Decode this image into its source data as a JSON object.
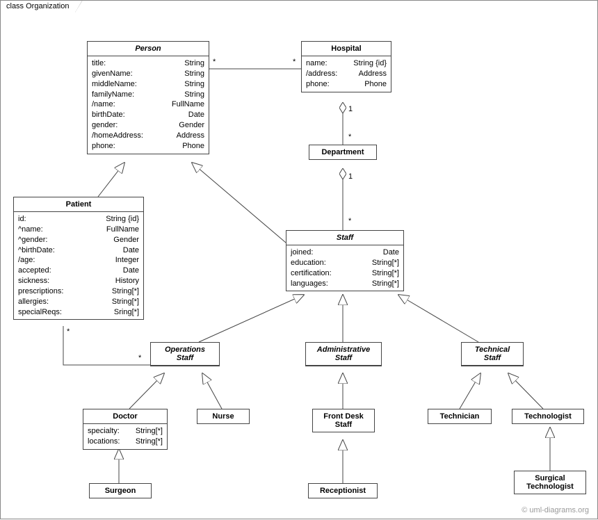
{
  "frame": {
    "title": "class Organization"
  },
  "copyright": "© uml-diagrams.org",
  "classes": {
    "person": {
      "title": "Person",
      "attrs": [
        {
          "k": "title:",
          "v": "String"
        },
        {
          "k": "givenName:",
          "v": "String"
        },
        {
          "k": "middleName:",
          "v": "String"
        },
        {
          "k": "familyName:",
          "v": "String"
        },
        {
          "k": "/name:",
          "v": "FullName"
        },
        {
          "k": "birthDate:",
          "v": "Date"
        },
        {
          "k": "gender:",
          "v": "Gender"
        },
        {
          "k": "/homeAddress:",
          "v": "Address"
        },
        {
          "k": "phone:",
          "v": "Phone"
        }
      ]
    },
    "hospital": {
      "title": "Hospital",
      "attrs": [
        {
          "k": "name:",
          "v": "String {id}"
        },
        {
          "k": "/address:",
          "v": "Address"
        },
        {
          "k": "phone:",
          "v": "Phone"
        }
      ]
    },
    "department": {
      "title": "Department"
    },
    "patient": {
      "title": "Patient",
      "attrs": [
        {
          "k": "id:",
          "v": "String {id}"
        },
        {
          "k": "^name:",
          "v": "FullName"
        },
        {
          "k": "^gender:",
          "v": "Gender"
        },
        {
          "k": "^birthDate:",
          "v": "Date"
        },
        {
          "k": "/age:",
          "v": "Integer"
        },
        {
          "k": "accepted:",
          "v": "Date"
        },
        {
          "k": "sickness:",
          "v": "History"
        },
        {
          "k": "prescriptions:",
          "v": "String[*]"
        },
        {
          "k": "allergies:",
          "v": "String[*]"
        },
        {
          "k": "specialReqs:",
          "v": "Sring[*]"
        }
      ]
    },
    "staff": {
      "title": "Staff",
      "attrs": [
        {
          "k": "joined:",
          "v": "Date"
        },
        {
          "k": "education:",
          "v": "String[*]"
        },
        {
          "k": "certification:",
          "v": "String[*]"
        },
        {
          "k": "languages:",
          "v": "String[*]"
        }
      ]
    },
    "opsStaff": {
      "title1": "Operations",
      "title2": "Staff"
    },
    "adminStaff": {
      "title1": "Administrative",
      "title2": "Staff"
    },
    "techStaff": {
      "title1": "Technical",
      "title2": "Staff"
    },
    "doctor": {
      "title": "Doctor",
      "attrs": [
        {
          "k": "specialty:",
          "v": "String[*]"
        },
        {
          "k": "locations:",
          "v": "String[*]"
        }
      ]
    },
    "nurse": {
      "title": "Nurse"
    },
    "frontDesk": {
      "title1": "Front Desk",
      "title2": "Staff"
    },
    "technician": {
      "title": "Technician"
    },
    "technologist": {
      "title": "Technologist"
    },
    "surgeon": {
      "title": "Surgeon"
    },
    "receptionist": {
      "title": "Receptionist"
    },
    "surgTech": {
      "title1": "Surgical",
      "title2": "Technologist"
    }
  },
  "mult": {
    "personHospL": "*",
    "personHospR": "*",
    "hospDept1": "1",
    "hospDeptStar": "*",
    "deptStaff1": "1",
    "deptStaffStar": "*",
    "patientOpsP": "*",
    "patientOpsO": "*"
  }
}
